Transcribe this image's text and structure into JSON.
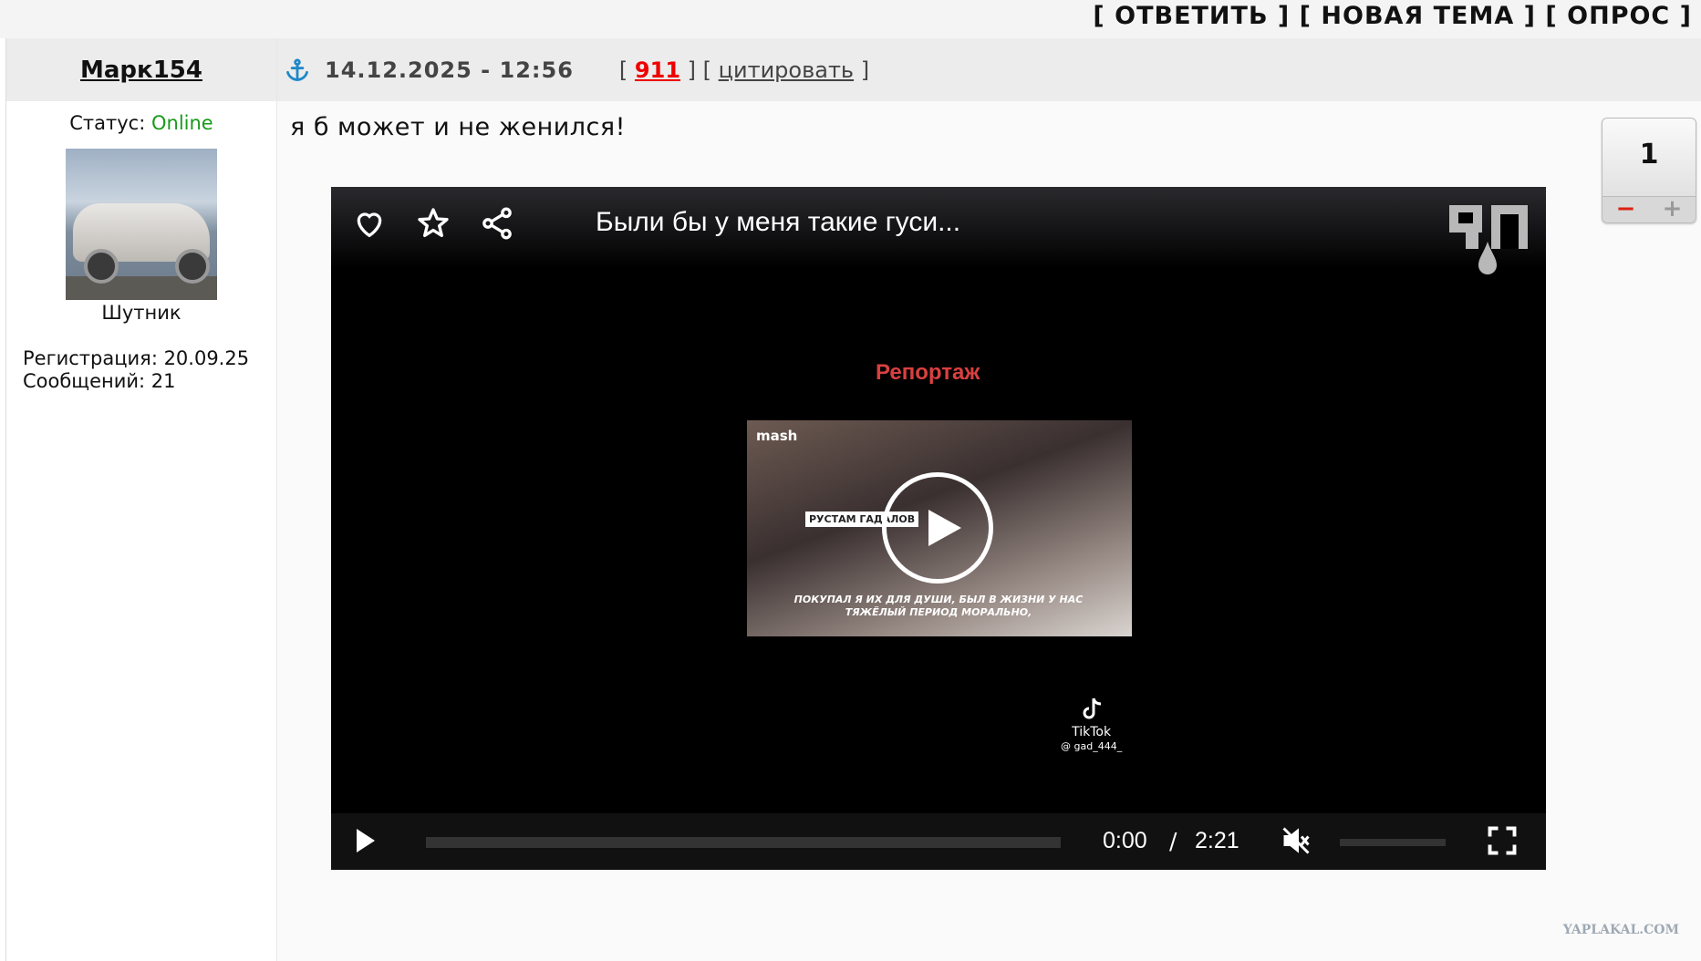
{
  "topbar": {
    "reply_label": "[ ОТВЕТИТЬ ]",
    "new_topic_label": "[ НОВАЯ ТЕМА ]",
    "poll_label": "[ ОПРОС ]"
  },
  "user": {
    "name": "Марк154",
    "status_label": "Статус:",
    "status_value": "Online",
    "rank": "Шутник",
    "registration": "Регистрация: 20.09.25",
    "messages": "Сообщений: 21"
  },
  "post": {
    "date": "14.12.2025 - 12:56",
    "link_open": "[",
    "number": "911",
    "link_mid": "] [",
    "quote_label": "цитировать",
    "link_close": "]",
    "text": "я б может и не женился!",
    "rating": "1",
    "rating_minus": "−",
    "rating_plus": "+"
  },
  "video": {
    "title": "Были бы у меня такие гуси...",
    "overlay_heading": "Репортаж",
    "frame_brand": "mash",
    "frame_name_badge": "РУСТАМ ГАДАЛОВ",
    "frame_caption": "ПОКУПАЛ Я ИХ ДЛЯ ДУШИ, БЫЛ В ЖИЗНИ У НАС ТЯЖЁЛЫЙ ПЕРИОД МОРАЛЬНО,",
    "tiktok_label": "TikTok",
    "tiktok_handle": "@ gad_444_",
    "current_time": "0:00",
    "separator": "/",
    "duration": "2:21",
    "progress": 0
  },
  "watermark": "YAPLAKAL.COM",
  "colors": {
    "online": "#1a9a1a",
    "post_number": "#e00000",
    "anchor": "#1e88c8",
    "report_heading": "#d94040"
  }
}
